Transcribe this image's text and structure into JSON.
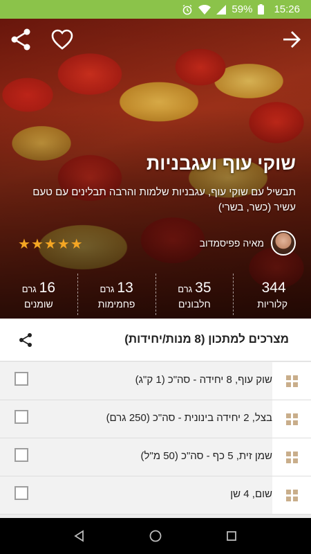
{
  "status": {
    "battery": "59%",
    "time": "15:26",
    "icons": [
      "alarm-icon",
      "wifi-icon",
      "signal-icon",
      "battery-icon"
    ]
  },
  "recipe": {
    "title": "שוקי עוף ועגבניות",
    "subtitle": "תבשיל עם שוקי עוף, עגבניות שלמות והרבה תבלינים עם טעם עשיר (כשר, בשרי)",
    "author": "מאיה פפיסמדוב",
    "rating": 5
  },
  "nutrition": [
    {
      "value": "344",
      "unit": "",
      "label": "קלוריות"
    },
    {
      "value": "35",
      "unit": "גרם",
      "label": "חלבונים"
    },
    {
      "value": "13",
      "unit": "גרם",
      "label": "פחמימות"
    },
    {
      "value": "16",
      "unit": "גרם",
      "label": "שומנים"
    }
  ],
  "ingredients": {
    "header": "מצרכים למתכון (8 מנות/יחידות)",
    "items": [
      "שוק עוף, 8 יחידה - סה\"כ (1 ק\"ג)",
      "בצל, 2 יחידה בינונית - סה\"כ (250 גרם)",
      "שמן זית, 5 כף - סה\"כ (50 מ\"ל)",
      "שום, 4 שן"
    ]
  },
  "colors": {
    "status_bar": "#8bc34a",
    "star": "#f5a623",
    "handle": "#c9ae8b"
  }
}
